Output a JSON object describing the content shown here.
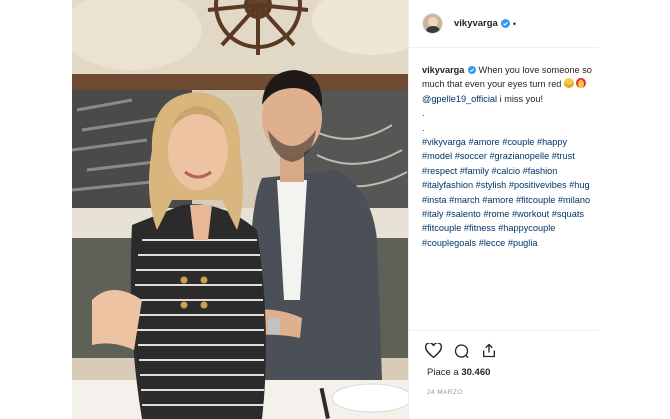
{
  "post": {
    "username": "vikyvarga",
    "verified": true,
    "menu_dot": "•",
    "caption": {
      "author": "vikyvarga",
      "text_line1": "When you love someone so much that even your eyes turn red",
      "mention": "@gpelle19_official",
      "text_line2": "i miss you!",
      "filler1": ".",
      "filler2": ".",
      "hashtags": [
        "#vikyvarga",
        "#amore",
        "#couple",
        "#happy",
        "#model",
        "#soccer",
        "#grazianopelle",
        "#trust",
        "#respect",
        "#family",
        "#calcio",
        "#fashion",
        "#italyfashion",
        "#stylish",
        "#positivevibes",
        "#hug",
        "#insta",
        "#march",
        "#amore",
        "#fitcouple",
        "#milano",
        "#italy",
        "#salento",
        "#rome",
        "#workout",
        "#squats",
        "#fitcouple",
        "#fitness",
        "#happycouple",
        "#couplegoals",
        "#lecce",
        "#puglia"
      ],
      "emojis": [
        "grimacing-face",
        "heart-eyes-face"
      ]
    },
    "likes_label": "Piace a",
    "likes_count": "30.460",
    "date": "24 MARZO",
    "icons": [
      "heart-icon",
      "comment-icon",
      "share-icon"
    ],
    "colors": {
      "hashtag": "#003569",
      "text": "#262626",
      "muted": "#999999",
      "verified": "#3897f0",
      "border": "#efefef"
    }
  }
}
